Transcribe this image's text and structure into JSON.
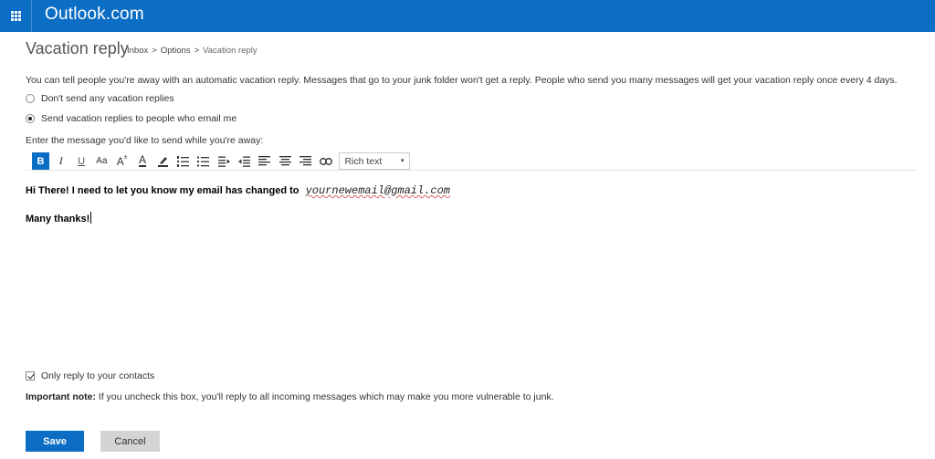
{
  "header": {
    "app_title": "Outlook.com",
    "app_launcher_icon": "waffle-grid-icon"
  },
  "page": {
    "title": "Vacation reply",
    "breadcrumb": [
      {
        "label": "Inbox"
      },
      {
        "label": "Options"
      },
      {
        "label": "Vacation reply"
      }
    ],
    "breadcrumb_separator": ">"
  },
  "intro_text": "You can tell people you're away with an automatic vacation reply. Messages that go to your junk folder won't get a reply. People who send you many messages will get your vacation reply once every 4 days.",
  "options": [
    {
      "label": "Don't send any vacation replies",
      "checked": false
    },
    {
      "label": "Send vacation replies to people who email me",
      "checked": true
    }
  ],
  "message_prompt": "Enter the message you'd like to send while you're away:",
  "toolbar": {
    "buttons": [
      {
        "name": "bold",
        "glyph": "B",
        "active": true
      },
      {
        "name": "italic",
        "glyph": "I"
      },
      {
        "name": "underline",
        "glyph": "U"
      },
      {
        "name": "font-size",
        "glyph": "Aa"
      },
      {
        "name": "grow-font",
        "glyph": "A"
      },
      {
        "name": "font-color",
        "glyph": "A"
      },
      {
        "name": "highlight",
        "glyph": ""
      },
      {
        "name": "numbered-list",
        "glyph": ""
      },
      {
        "name": "bulleted-list",
        "glyph": ""
      },
      {
        "name": "decrease-indent",
        "glyph": ""
      },
      {
        "name": "increase-indent",
        "glyph": ""
      },
      {
        "name": "align-left",
        "glyph": ""
      },
      {
        "name": "align-center",
        "glyph": ""
      },
      {
        "name": "align-right",
        "glyph": ""
      },
      {
        "name": "insert-link",
        "glyph": ""
      }
    ],
    "format_select": {
      "value": "Rich text",
      "arrow": "▾"
    }
  },
  "editor": {
    "line1_text": "Hi There! I need to let you know my email has changed to",
    "line1_email": "yournewemail@gmail.com",
    "line2_text": "Many thanks!"
  },
  "contacts_only": {
    "label": "Only reply to your contacts",
    "checked": true
  },
  "note": {
    "bold": "Important note:",
    "text": " If you uncheck this box, you'll reply to all incoming messages which may make you more vulnerable to junk."
  },
  "actions": {
    "save_label": "Save",
    "cancel_label": "Cancel"
  },
  "colors": {
    "brand_blue": "#0c6dc4",
    "cancel_gray": "#d4d4d4"
  }
}
